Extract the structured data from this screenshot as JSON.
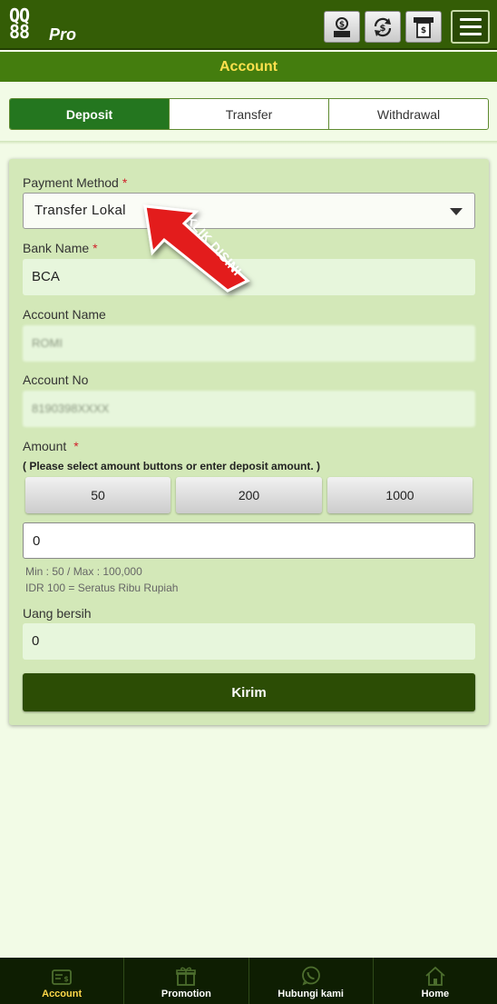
{
  "header": {
    "logo_line1": "QQ",
    "logo_line2": "88",
    "logo_suffix": "Pro",
    "icons": [
      "deposit-icon",
      "transfer-icon",
      "withdraw-icon",
      "menu-icon"
    ]
  },
  "page": {
    "title": "Account"
  },
  "tabs": [
    {
      "label": "Deposit",
      "active": true
    },
    {
      "label": "Transfer",
      "active": false
    },
    {
      "label": "Withdrawal",
      "active": false
    }
  ],
  "form": {
    "payment_method": {
      "label": "Payment Method",
      "required": "*",
      "value": "Transfer Lokal"
    },
    "bank_name": {
      "label": "Bank Name",
      "required": "*",
      "value": "BCA"
    },
    "account_name": {
      "label": "Account Name",
      "value": "ROMI"
    },
    "account_no": {
      "label": "Account No",
      "value": "8190398XXXX"
    },
    "amount": {
      "label": "Amount",
      "required": "*",
      "hint": "( Please select amount buttons or enter deposit amount. )",
      "buttons": [
        "50",
        "200",
        "1000"
      ],
      "value": "0",
      "limits": "Min : 50 / Max : 100,000",
      "conversion": "IDR 100 = Seratus Ribu Rupiah"
    },
    "net": {
      "label": "Uang bersih",
      "value": "0"
    },
    "submit_label": "Kirim"
  },
  "annotation": {
    "text": "KLIK DISINI",
    "color": "#e31b1b"
  },
  "bottom_nav": [
    {
      "label": "Account",
      "icon": "wallet-icon",
      "active": true
    },
    {
      "label": "Promotion",
      "icon": "gift-icon",
      "active": false
    },
    {
      "label": "Hubungi kami",
      "icon": "whatsapp-icon",
      "active": false
    },
    {
      "label": "Home",
      "icon": "home-icon",
      "active": false
    }
  ],
  "colors": {
    "header": "#345d06",
    "title_bar": "#447d0e",
    "title_text": "#ffe14d",
    "active_tab": "#24761f",
    "card": "#d3e8b8",
    "submit": "#2c4d05",
    "nav_active": "#ffd84a"
  }
}
